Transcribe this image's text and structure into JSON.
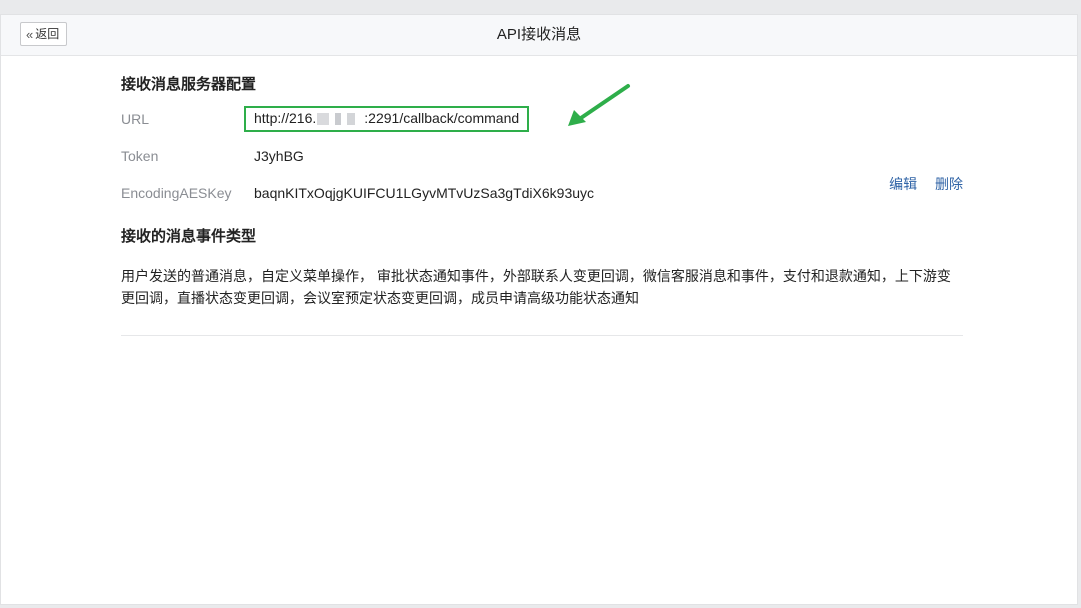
{
  "header": {
    "back_label": "返回",
    "back_icon": "double-chevron-left-icon",
    "title": "API接收消息"
  },
  "server_config": {
    "section_title": "接收消息服务器配置",
    "url_label": "URL",
    "url_prefix": "http://216.",
    "url_suffix": ":2291/callback/command",
    "token_label": "Token",
    "token_value": "J3yhBG",
    "aes_label": "EncodingAESKey",
    "aes_value": "baqnKITxOqjgKUIFCU1LGyvMTvUzSa3gTdiX6k93uyc",
    "edit_label": "编辑",
    "delete_label": "删除"
  },
  "events": {
    "section_title": "接收的消息事件类型",
    "description": "用户发送的普通消息，自定义菜单操作， 审批状态通知事件，外部联系人变更回调，微信客服消息和事件，支付和退款通知，上下游变更回调，直播状态变更回调，会议室预定状态变更回调，成员申请高级功能状态通知"
  },
  "colors": {
    "highlight_box": "#2eae4a",
    "annotation_arrow": "#2eae4a",
    "link": "#2f63a6"
  }
}
